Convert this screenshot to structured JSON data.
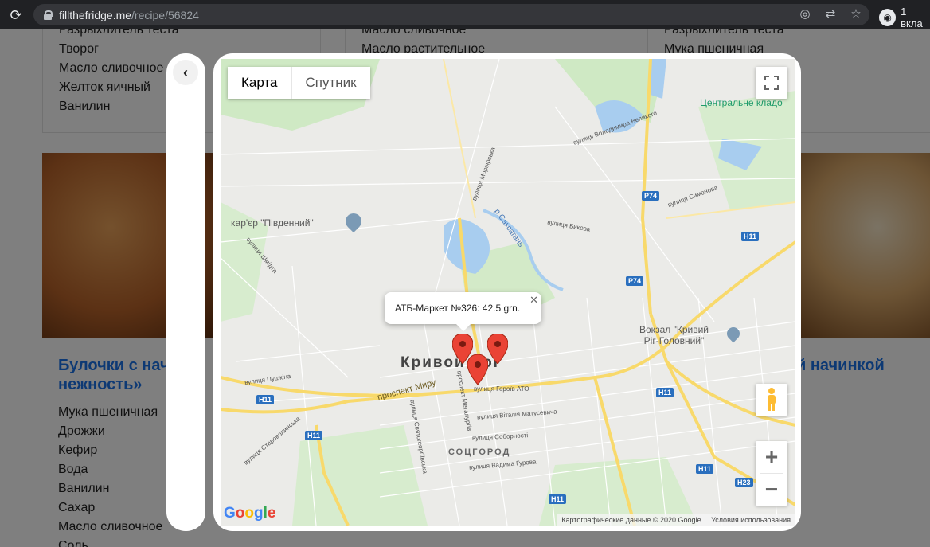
{
  "browser": {
    "url_host": "fillthefridge.me",
    "url_path": "/recipe/56824",
    "profile_label": "1 вкла"
  },
  "page": {
    "card1_ingredients": [
      "Разрыхлитель теста",
      "Творог",
      "Масло сливочное",
      "Желток яичный",
      "Ванилин"
    ],
    "card2_ingredients": [
      "Масло сливочное",
      "Масло растительное"
    ],
    "card3_ingredients": [
      "Разрыхлитель теста",
      "Мука пшеничная"
    ],
    "recipe_left_title": "Булочки с нач нежность»",
    "recipe_left_title_line1": "Булочки с нач",
    "recipe_left_title_line2": "нежность»",
    "recipe_left_ingredients": [
      "Мука пшеничная",
      "Дрожжи",
      "Кефир",
      "Вода",
      "Ванилин",
      "Сахар",
      "Масло сливочное",
      "Соль"
    ],
    "recipe_right_title": "й начинкой"
  },
  "map": {
    "tabs": [
      "Карта",
      "Спутник"
    ],
    "active_tab": "Карта",
    "info_window_text": "АТБ-Маркет №326: 42.5 grn.",
    "city_label": "Кривой Рог",
    "district_label": "СОЦГОРОД",
    "places": {
      "quarry": "кар'єр \"Південний\"",
      "station": "Вокзал \"Кривий Ріг-Головний\"",
      "station_line1": "Вокзал \"Кривий",
      "station_line2": "Ріг-Головний\"",
      "cemetery": "Центральне кладо"
    },
    "river": "р.Саксагань",
    "streets": [
      "вулиця Шмідта",
      "вулиця Пушкіна",
      "проспект Миру",
      "вулиця Героїв АТО",
      "вулиця Віталія Матусевича",
      "вулиця Соборності",
      "вулиця Вадима Гурова",
      "вулиця Староволинська",
      "вулиця Святогеоргіївська",
      "проспект Металургів",
      "вулиця Володимира Великого",
      "вулиця Симонова",
      "вулиця Бикова",
      "вулиця Моріярська"
    ],
    "road_tags": [
      "P74",
      "H11",
      "H11",
      "H11",
      "H11",
      "H11",
      "H23",
      "P74",
      "H11"
    ],
    "google_logo": "Google",
    "attribution": "Картографические данные © 2020 Google",
    "terms": "Условия использования",
    "accent_color": "#ea4335"
  }
}
